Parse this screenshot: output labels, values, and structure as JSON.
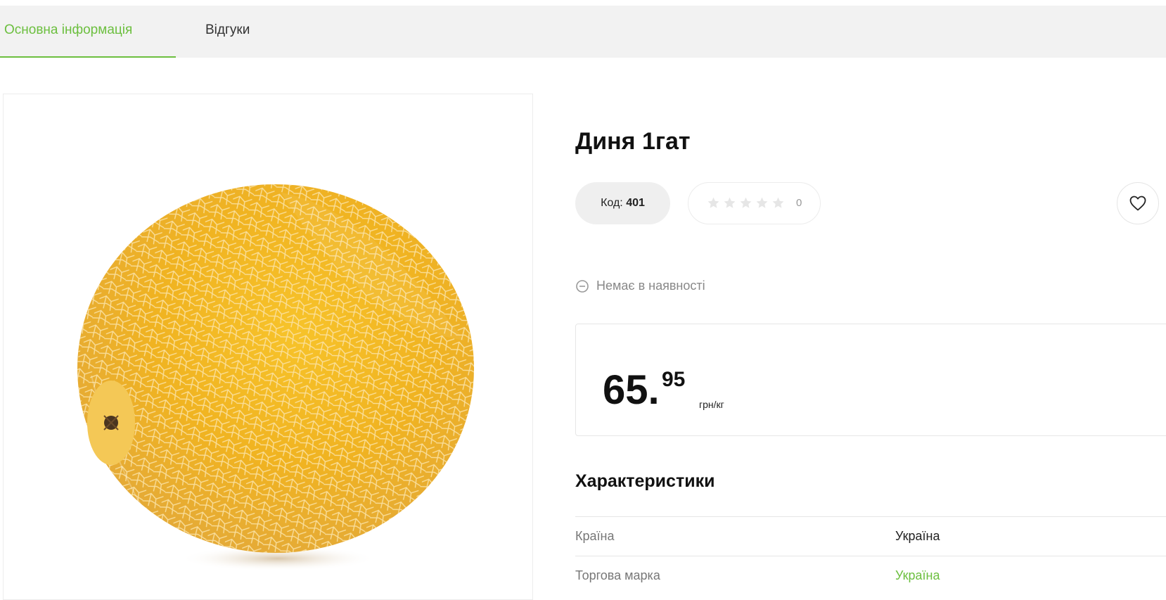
{
  "tabs": [
    {
      "label": "Основна інформація",
      "active": true
    },
    {
      "label": "Відгуки",
      "active": false
    }
  ],
  "product": {
    "title": "Диня 1гат",
    "code_label": "Код:",
    "code_value": "401",
    "rating_count": "0",
    "rating_stars": 0,
    "stock_status": "Немає в наявності",
    "image_alt_icon": "melon-image",
    "favorite_icon": "heart-icon"
  },
  "price": {
    "integer": "65.",
    "fraction": "95",
    "unit": "грн/кг"
  },
  "characteristics": {
    "title": "Характеристики",
    "rows": [
      {
        "key": "Країна",
        "value": "Україна",
        "link": false
      },
      {
        "key": "Торгова марка",
        "value": "Україна",
        "link": true
      }
    ]
  },
  "colors": {
    "accent": "#6cbf3f",
    "tabbar_bg": "#f2f2f2",
    "star_empty": "#e6e6e6"
  }
}
